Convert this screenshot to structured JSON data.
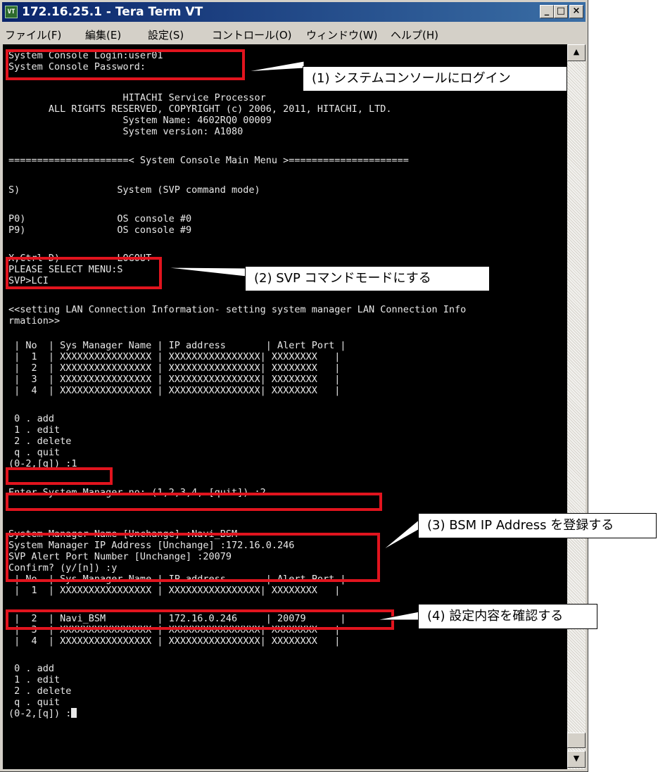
{
  "window": {
    "title": "172.16.25.1 - Tera Term VT",
    "icon_label": "VT",
    "controls": {
      "minimize": "_",
      "maximize": "□",
      "close": "×"
    }
  },
  "menu": [
    "ファイル(F)",
    "編集(E)",
    "設定(S)",
    "コントロール(O)",
    "ウィンドウ(W)",
    "ヘルプ(H)"
  ],
  "terminal": {
    "lines": [
      "System Console Login:user01",
      "System Console Password:",
      "",
      "                    HITACHI Service Processor",
      "       ALL RIGHTS RESERVED, COPYRIGHT (c) 2006, 2011, HITACHI, LTD.",
      "                    System Name: 4602RQ0 00009",
      "                    System version: A1080",
      "",
      "=====================< System Console Main Menu >=====================",
      "",
      "S)                 System (SVP command mode)",
      "",
      "P0)                OS console #0",
      "P9)                OS console #9",
      "",
      "X,Ctrl-D)          LOGOUT",
      "PLEASE SELECT MENU:S",
      "SVP>LCI",
      "",
      "<<setting LAN Connection Information- setting system manager LAN Connection Info",
      "rmation>>",
      "",
      " | No  | Sys Manager Name | IP address       | Alert Port |",
      " |  1  | XXXXXXXXXXXXXXXX | XXXXXXXXXXXXXXXX| XXXXXXXX   |",
      " |  2  | XXXXXXXXXXXXXXXX | XXXXXXXXXXXXXXXX| XXXXXXXX   |",
      " |  3  | XXXXXXXXXXXXXXXX | XXXXXXXXXXXXXXXX| XXXXXXXX   |",
      " |  4  | XXXXXXXXXXXXXXXX | XXXXXXXXXXXXXXXX| XXXXXXXX   |",
      "",
      " 0 . add",
      " 1 . edit",
      " 2 . delete",
      " q . quit",
      "(0-2,[q]) :1",
      "",
      "Enter System Manager no: (1,2,3,4, [quit]) :2",
      "",
      "",
      "System Manager Name [Unchange] :Navi_BSM",
      "System Manager IP Address [Unchange] :172.16.0.246",
      "SVP Alert Port Number [Unchange] :20079",
      "Confirm? (y/[n]) :y",
      " | No  | Sys Manager Name | IP address       | Alert Port |",
      " |  1  | XXXXXXXXXXXXXXXX | XXXXXXXXXXXXXXXX| XXXXXXXX   |",
      " |  2  | Navi_BSM         | 172.16.0.246     | 20079      |",
      " |  3  | XXXXXXXXXXXXXXXX | XXXXXXXXXXXXXXXX| XXXXXXXX   |",
      " |  4  | XXXXXXXXXXXXXXXX | XXXXXXXXXXXXXXXX| XXXXXXXX   |",
      "",
      " 0 . add",
      " 1 . edit",
      " 2 . delete",
      " q . quit",
      "(0-2,[q]) :"
    ]
  },
  "callouts": [
    "(1) システムコンソールにログイン",
    "(2) SVP コマンドモードにする",
    "(3) BSM IP Address を登録する",
    "(4) 設定内容を確認する"
  ],
  "colors": {
    "highlight": "#e1141e",
    "titlebar_start": "#0a246a",
    "titlebar_end": "#3a6ea5",
    "terminal_bg": "#000000",
    "terminal_fg": "#e8e8e8"
  }
}
